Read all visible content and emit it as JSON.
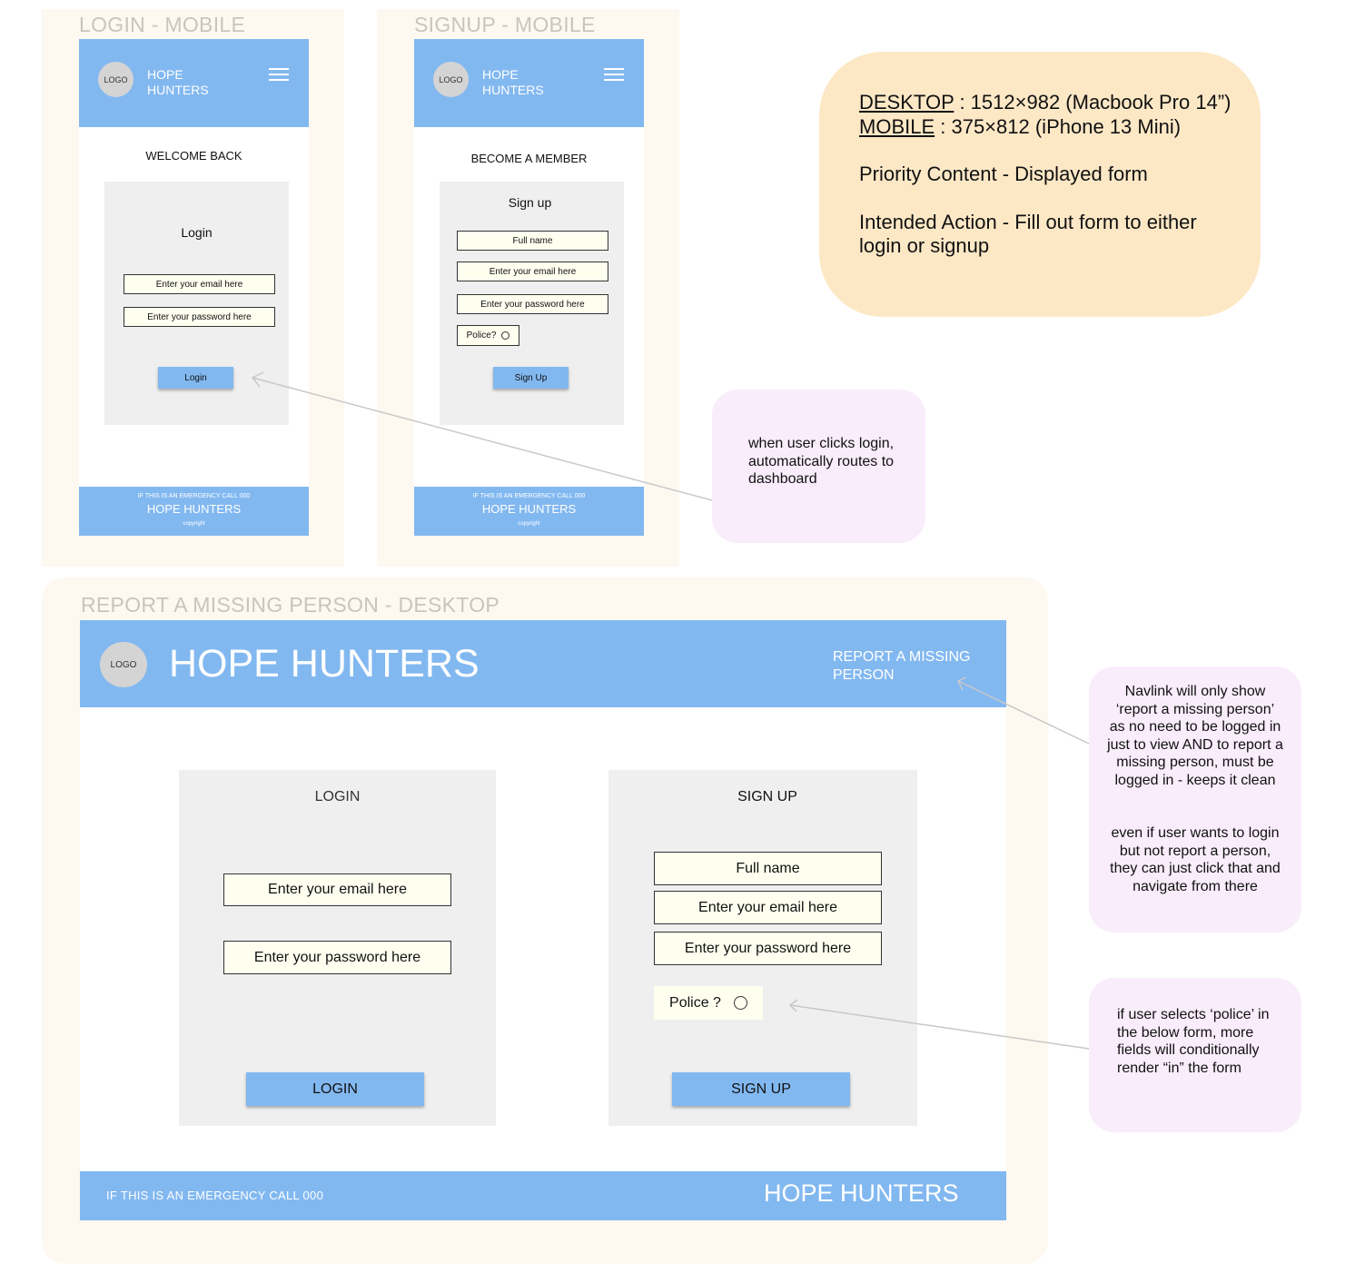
{
  "login_mobile": {
    "frame_title": "LOGIN - MOBILE",
    "logo": "LOGO",
    "brand": "HOPE HUNTERS",
    "menu_icon": "hamburger-icon",
    "heading": "WELCOME BACK",
    "card_title": "Login",
    "email_placeholder": "Enter your email here",
    "password_placeholder": "Enter your password here",
    "button": "Login",
    "footer": {
      "emergency": "IF THIS IS AN EMERGENCY CALL 000",
      "brand": "HOPE HUNTERS",
      "copyright": "copyright"
    }
  },
  "signup_mobile": {
    "frame_title": "SIGNUP - MOBILE",
    "logo": "LOGO",
    "brand": "HOPE HUNTERS",
    "menu_icon": "hamburger-icon",
    "heading": "BECOME A MEMBER",
    "card_title": "Sign up",
    "fullname_placeholder": "Full name",
    "email_placeholder": "Enter your email here",
    "password_placeholder": "Enter your password here",
    "police_label": "Police?",
    "button": "Sign Up",
    "footer": {
      "emergency": "IF THIS IS AN EMERGENCY CALL 000",
      "brand": "HOPE HUNTERS",
      "copyright": "copyright"
    }
  },
  "info_note": {
    "desktop_label": "DESKTOP",
    "desktop_value": " : 1512×982 (Macbook Pro 14”)",
    "mobile_label": "MOBILE",
    "mobile_value": " : 375×812 (iPhone 13 Mini)",
    "priority": "Priority Content - Displayed form",
    "intended": "Intended Action - Fill out form to either login or signup"
  },
  "notes": {
    "login_route": "when user clicks login, automatically routes to dashboard",
    "navlink_1": "Navlink will only show ‘report a missing person’ as no need to be logged in just to view AND to report a missing person, must be logged in - keeps it clean",
    "navlink_2": "even if user wants to login but not report a person, they can just click that and navigate from there",
    "police": "if user selects ‘police’ in the below form, more fields will conditionally render “in” the form"
  },
  "desktop": {
    "frame_title": "REPORT A MISSING PERSON - DESKTOP",
    "logo": "LOGO",
    "brand": "HOPE HUNTERS",
    "nav_link": "REPORT A MISSING PERSON",
    "login": {
      "title": "LOGIN",
      "email_placeholder": "Enter your email here",
      "password_placeholder": "Enter your password here",
      "button": "LOGIN"
    },
    "signup": {
      "title": "SIGN UP",
      "fullname_placeholder": "Full name",
      "email_placeholder": "Enter your email here",
      "password_placeholder": "Enter your password here",
      "police_label": "Police ?",
      "button": "SIGN UP"
    },
    "footer": {
      "emergency": "IF THIS IS AN EMERGENCY CALL 000",
      "brand": "HOPE HUNTERS"
    }
  },
  "colors": {
    "header_blue": "#82b8f0",
    "input_fill": "#fffff0",
    "card_grey": "#efefef",
    "info_note_bg": "#fde8c6",
    "annotation_bg": "#f9ecfb",
    "frame_bg": "#fdf8f0"
  }
}
